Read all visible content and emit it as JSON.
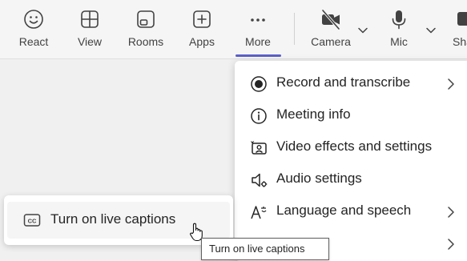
{
  "toolbar": {
    "react_label": "React",
    "view_label": "View",
    "rooms_label": "Rooms",
    "apps_label": "Apps",
    "more_label": "More",
    "camera_label": "Camera",
    "mic_label": "Mic",
    "share_label": "Share"
  },
  "menu": {
    "items": [
      {
        "label": "Record and transcribe",
        "icon": "record-icon"
      },
      {
        "label": "Meeting info",
        "icon": "info-icon"
      },
      {
        "label": "Video effects and settings",
        "icon": "video-effects-icon"
      },
      {
        "label": "Audio settings",
        "icon": "speaker-settings-icon"
      },
      {
        "label": "Language and speech",
        "icon": "language-icon"
      }
    ]
  },
  "captions_popup": {
    "item_label": "Turn on live captions",
    "icon": "closed-captions-icon"
  },
  "tooltip": {
    "text": "Turn on live captions"
  },
  "colors": {
    "accent": "#5b5fc7",
    "background": "#f0f0f0",
    "surface": "#ffffff"
  }
}
